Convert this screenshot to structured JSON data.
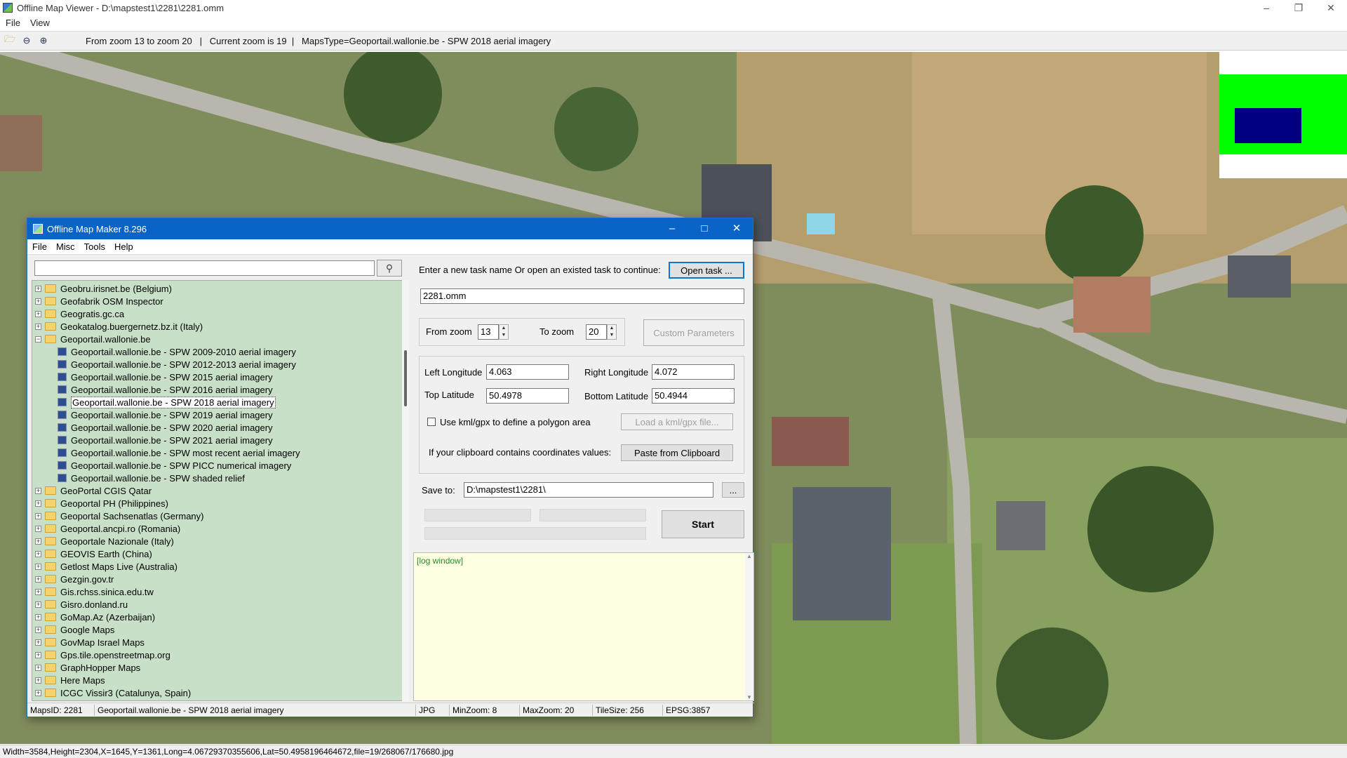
{
  "viewer": {
    "title": "Offline Map Viewer - D:\\mapstest1\\2281\\2281.omm",
    "menu": [
      "File",
      "View"
    ],
    "toolbar_info": "From zoom 13 to zoom 20   |   Current zoom is 19  |   MapsType=Geoportail.wallonie.be - SPW 2018 aerial imagery",
    "status": "Width=3584,Height=2304,X=1645,Y=1361,Long=4.06729370355606,Lat=50.4958196464672,file=19/268067/176680.jpg"
  },
  "dialog": {
    "title": "Offline Map Maker 8.296",
    "menu": [
      "File",
      "Misc",
      "Tools",
      "Help"
    ],
    "search_placeholder": "",
    "tree": [
      {
        "label": "Geobru.irisnet.be (Belgium)",
        "level": 0,
        "expanded": false
      },
      {
        "label": "Geofabrik OSM Inspector",
        "level": 0,
        "expanded": false
      },
      {
        "label": "Geogratis.gc.ca",
        "level": 0,
        "expanded": false
      },
      {
        "label": "Geokatalog.buergernetz.bz.it (Italy)",
        "level": 0,
        "expanded": false
      },
      {
        "label": "Geoportail.wallonie.be",
        "level": 0,
        "expanded": true
      },
      {
        "label": "Geoportail.wallonie.be - SPW 2009-2010 aerial imagery",
        "level": 1
      },
      {
        "label": "Geoportail.wallonie.be - SPW 2012-2013 aerial imagery",
        "level": 1
      },
      {
        "label": "Geoportail.wallonie.be - SPW 2015 aerial imagery",
        "level": 1
      },
      {
        "label": "Geoportail.wallonie.be - SPW 2016 aerial imagery",
        "level": 1
      },
      {
        "label": "Geoportail.wallonie.be - SPW 2018 aerial imagery",
        "level": 1,
        "selected": true
      },
      {
        "label": "Geoportail.wallonie.be - SPW 2019 aerial imagery",
        "level": 1
      },
      {
        "label": "Geoportail.wallonie.be - SPW 2020 aerial imagery",
        "level": 1
      },
      {
        "label": "Geoportail.wallonie.be - SPW 2021 aerial imagery",
        "level": 1
      },
      {
        "label": "Geoportail.wallonie.be - SPW most recent aerial imagery",
        "level": 1
      },
      {
        "label": "Geoportail.wallonie.be - SPW PICC numerical imagery",
        "level": 1
      },
      {
        "label": "Geoportail.wallonie.be - SPW shaded relief",
        "level": 1
      },
      {
        "label": "GeoPortal CGIS Qatar",
        "level": 0,
        "expanded": false
      },
      {
        "label": "Geoportal PH (Philippines)",
        "level": 0,
        "expanded": false
      },
      {
        "label": "Geoportal Sachsenatlas (Germany)",
        "level": 0,
        "expanded": false
      },
      {
        "label": "Geoportal.ancpi.ro (Romania)",
        "level": 0,
        "expanded": false
      },
      {
        "label": "Geoportale Nazionale (Italy)",
        "level": 0,
        "expanded": false
      },
      {
        "label": "GEOVIS Earth (China)",
        "level": 0,
        "expanded": false
      },
      {
        "label": "Getlost Maps Live (Australia)",
        "level": 0,
        "expanded": false
      },
      {
        "label": "Gezgin.gov.tr",
        "level": 0,
        "expanded": false
      },
      {
        "label": "Gis.rchss.sinica.edu.tw",
        "level": 0,
        "expanded": false
      },
      {
        "label": "Gisro.donland.ru",
        "level": 0,
        "expanded": false
      },
      {
        "label": "GoMap.Az (Azerbaijan)",
        "level": 0,
        "expanded": false
      },
      {
        "label": "Google Maps",
        "level": 0,
        "expanded": false
      },
      {
        "label": "GovMap Israel Maps",
        "level": 0,
        "expanded": false
      },
      {
        "label": "Gps.tile.openstreetmap.org",
        "level": 0,
        "expanded": false
      },
      {
        "label": "GraphHopper Maps",
        "level": 0,
        "expanded": false
      },
      {
        "label": "Here Maps",
        "level": 0,
        "expanded": false
      },
      {
        "label": "ICGC Vissir3 (Catalunya, Spain)",
        "level": 0,
        "expanded": false
      }
    ],
    "task_prompt": "Enter a new task name Or open an existed task to continue:",
    "open_task_label": "Open task ...",
    "task_name": "2281.omm",
    "from_zoom_label": "From zoom",
    "from_zoom": "13",
    "to_zoom_label": "To zoom",
    "to_zoom": "20",
    "custom_params_label": "Custom Parameters",
    "left_lon_label": "Left Longitude",
    "left_lon": "4.063",
    "right_lon_label": "Right Longitude",
    "right_lon": "4.072",
    "top_lat_label": "Top Latitude",
    "top_lat": "50.4978",
    "bottom_lat_label": "Bottom Latitude",
    "bottom_lat": "50.4944",
    "kml_label": "Use kml/gpx to define a polygon area",
    "load_kml_label": "Load a kml/gpx file...",
    "clipboard_label": "If your clipboard contains coordinates values:",
    "paste_label": "Paste from Clipboard",
    "save_to_label": "Save to:",
    "save_to": "D:\\mapstest1\\2281\\",
    "browse_label": "...",
    "start_label": "Start",
    "log_text": "[log window]",
    "status": {
      "maps_id": "MapsID: 2281",
      "maps_name": "Geoportail.wallonie.be - SPW 2018 aerial imagery",
      "format": "JPG",
      "min_zoom": "MinZoom: 8",
      "max_zoom": "MaxZoom: 20",
      "tile_size": "TileSize: 256",
      "epsg": "EPSG:3857"
    }
  },
  "colors": {
    "dialog_title": "#0a64c8",
    "tree_bg": "#c8e0c8",
    "log_bg": "#ffffe1",
    "overview_green": "#00ff00",
    "overview_blue": "#000080"
  }
}
